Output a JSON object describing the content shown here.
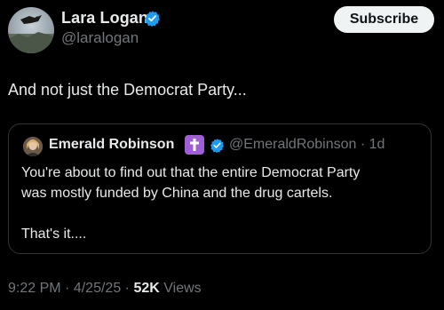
{
  "tweet": {
    "author": {
      "display_name": "Lara Logan",
      "handle": "@laralogan",
      "verified": true
    },
    "subscribe_label": "Subscribe",
    "text": "And not just the Democrat Party...",
    "quote": {
      "author": {
        "display_name": "Emerald Robinson",
        "handle": "@EmeraldRobinson",
        "verified": true,
        "badge_icon": "latin-cross-icon"
      },
      "age_separator": "·",
      "age": "1d",
      "text_line1": "You're about to find out that the entire Democrat Party",
      "text_line2": "was mostly funded by China and the drug cartels.",
      "text_line3": "That's it...."
    },
    "footer": {
      "time": "9:22 PM",
      "separator": "·",
      "date": "4/25/25",
      "views_count": "52K",
      "views_label": "Views"
    }
  },
  "colors": {
    "background": "#000000",
    "text_primary": "#e7e9ea",
    "text_secondary": "#71767b",
    "verified_blue": "#1d9bf0",
    "border": "#2f3336",
    "badge_purple": "#a15fd6",
    "button_bg": "#eff3f4"
  }
}
